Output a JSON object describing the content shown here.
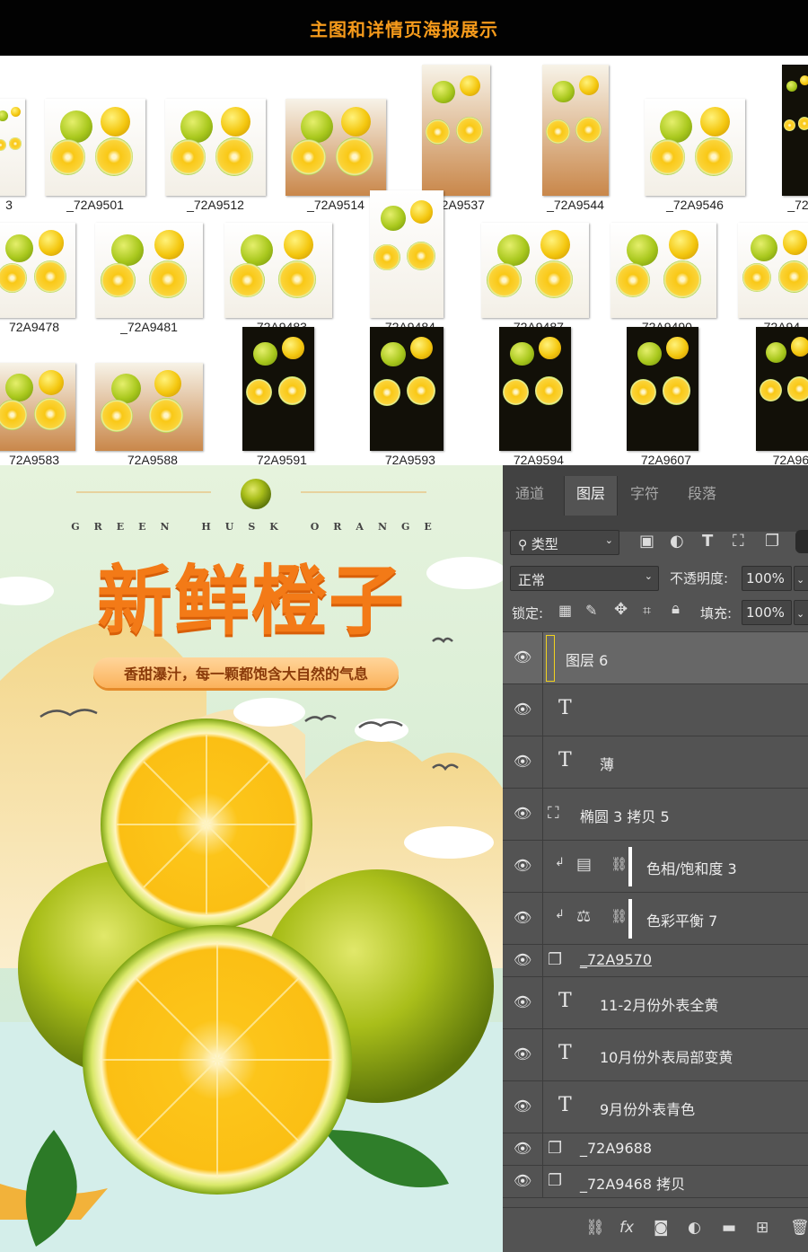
{
  "banner": {
    "title": "主图和详情页海报展示",
    "color": "#f59a1b"
  },
  "browser": {
    "thumbnails": [
      {
        "label": "3",
        "style": "white"
      },
      {
        "label": "_72A9501",
        "style": "white"
      },
      {
        "label": "_72A9512",
        "style": "white"
      },
      {
        "label": "_72A9514",
        "style": "wood"
      },
      {
        "label": "_72A9537",
        "style": "wood"
      },
      {
        "label": "_72A9544",
        "style": "wood"
      },
      {
        "label": "_72A9546",
        "style": "white"
      },
      {
        "label": "_72",
        "style": "dark"
      },
      {
        "label": "72A9478",
        "style": "white"
      },
      {
        "label": "_72A9481",
        "style": "white"
      },
      {
        "label": "_72A9483",
        "style": "white"
      },
      {
        "label": "_72A9484",
        "style": "white"
      },
      {
        "label": "_72A9487",
        "style": "white"
      },
      {
        "label": "_72A9490",
        "style": "white"
      },
      {
        "label": "_72A94",
        "style": "white"
      },
      {
        "label": "72A9583",
        "style": "wood"
      },
      {
        "label": "_72A9588",
        "style": "wood"
      },
      {
        "label": "_72A9591",
        "style": "dark"
      },
      {
        "label": "_72A9593",
        "style": "dark"
      },
      {
        "label": "_72A9594",
        "style": "dark"
      },
      {
        "label": "_72A9607",
        "style": "dark"
      },
      {
        "label": "_72A96",
        "style": "dark"
      }
    ]
  },
  "poster": {
    "subtitle_en": "GREEN HUSK ORANGE",
    "title": "新鲜橙子",
    "tagline": "香甜瀑汁，每一颗都饱含大自然的气息",
    "title_color": "#f37a17"
  },
  "ps_panel": {
    "tabs": [
      {
        "label": "通道",
        "active": false
      },
      {
        "label": "图层",
        "active": true
      },
      {
        "label": "字符",
        "active": false
      },
      {
        "label": "段落",
        "active": false
      }
    ],
    "filter_label": "类型",
    "blend_mode": "正常",
    "opacity_label": "不透明度:",
    "opacity_value": "100%",
    "lock_label": "锁定:",
    "fill_label": "填充:",
    "fill_value": "100%",
    "layers": [
      {
        "name": "图层 6",
        "kind": "pixel",
        "selected": true
      },
      {
        "name": "",
        "kind": "text"
      },
      {
        "name": "薄",
        "kind": "text"
      },
      {
        "name": "椭圆 3 拷贝 5",
        "kind": "shape"
      },
      {
        "name": "色相/饱和度 3",
        "kind": "adjust-hue"
      },
      {
        "name": "色彩平衡 7",
        "kind": "adjust-balance"
      },
      {
        "name": "_72A9570",
        "kind": "smart"
      },
      {
        "name": "11-2月份外表全黄",
        "kind": "text"
      },
      {
        "name": "10月份外表局部变黄",
        "kind": "text"
      },
      {
        "name": "9月份外表青色",
        "kind": "text"
      },
      {
        "name": "_72A9688",
        "kind": "smart"
      },
      {
        "name": "_72A9468 拷贝",
        "kind": "smart"
      }
    ],
    "footer_icons": [
      "link-icon",
      "fx-icon",
      "mask-icon",
      "adjustment-icon",
      "folder-icon",
      "new-layer-icon",
      "trash-icon"
    ]
  }
}
